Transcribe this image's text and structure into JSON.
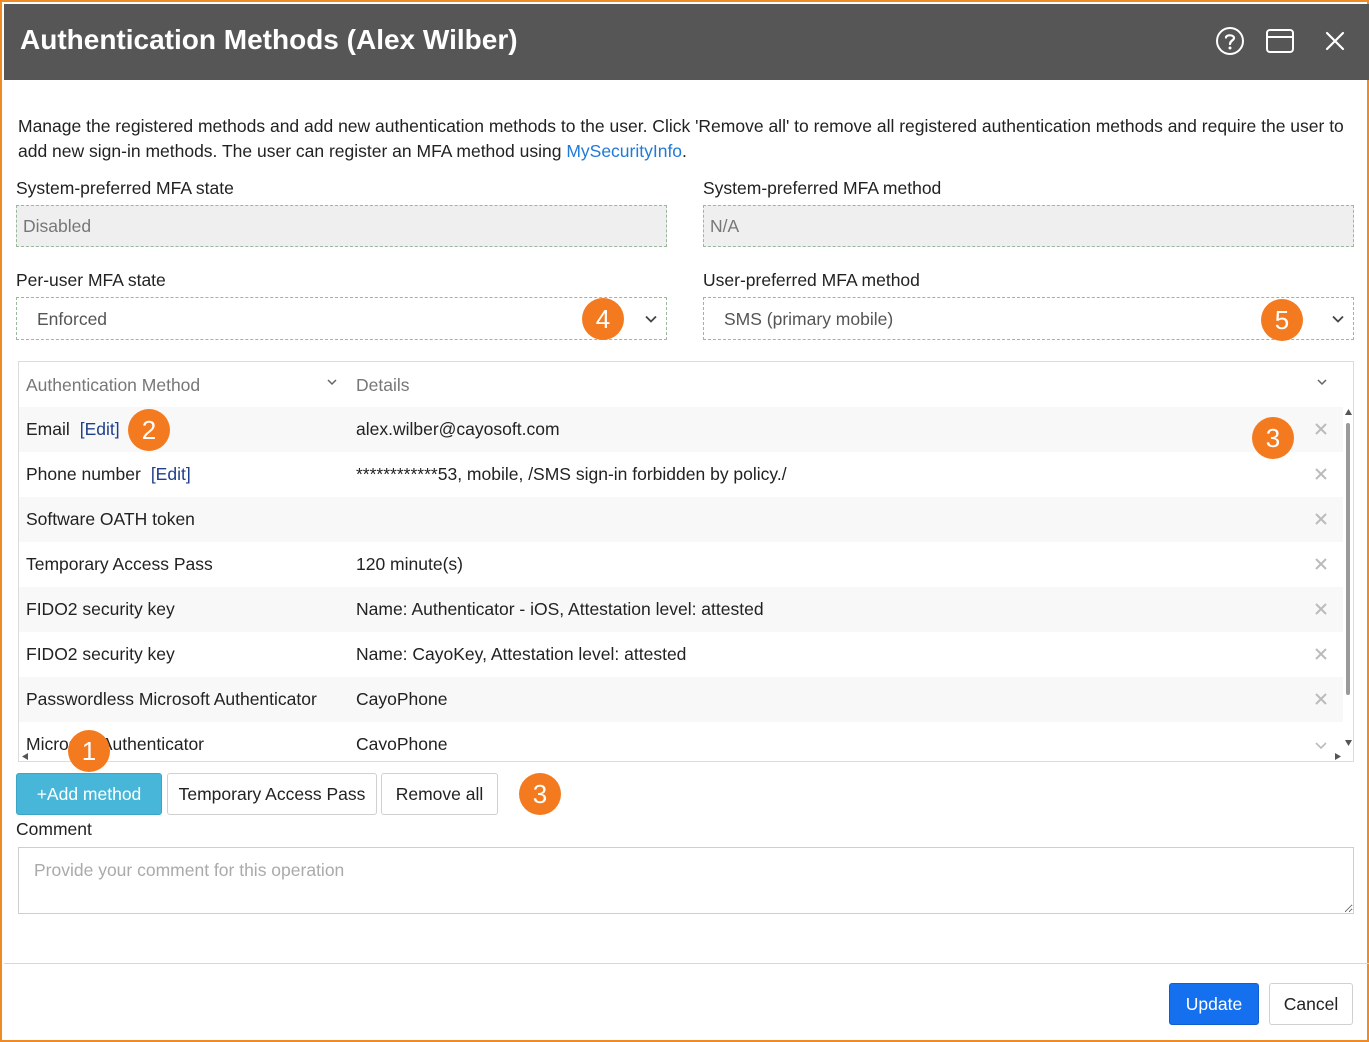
{
  "window": {
    "title": "Authentication Methods (Alex Wilber)",
    "icons": [
      "help-icon",
      "maximize-icon",
      "close-icon"
    ]
  },
  "description": {
    "text": "Manage the registered methods and add new authentication methods to the user. Click 'Remove all' to remove all registered authentication methods and require the user to add new sign-in methods. The user can register an MFA method using ",
    "link": "MySecurityInfo",
    "suffix": "."
  },
  "fields": {
    "system_state_label": "System-preferred MFA state",
    "system_state_value": "Disabled",
    "system_method_label": "System-preferred MFA method",
    "system_method_value": "N/A",
    "peruser_state_label": "Per-user MFA state",
    "peruser_state_value": "Enforced",
    "user_method_label": "User-preferred MFA method",
    "user_method_value": "SMS (primary mobile)"
  },
  "grid": {
    "col_method": "Authentication Method",
    "col_details": "Details",
    "edit_label": "[Edit]",
    "rows": [
      {
        "method": "Email",
        "details": "alex.wilber@cayosoft.com"
      },
      {
        "method": "Phone number",
        "details": "************53, mobile, /SMS sign-in forbidden by policy./"
      },
      {
        "method": "Software OATH token",
        "details": ""
      },
      {
        "method": "Temporary Access Pass",
        "details": "120 minute(s)"
      },
      {
        "method": "FIDO2 security key",
        "details": "Name: Authenticator - iOS, Attestation level: attested"
      },
      {
        "method": "FIDO2 security key",
        "details": "Name: CayoKey, Attestation level: attested"
      },
      {
        "method": "Passwordless Microsoft Authenticator",
        "details": "CayoPhone"
      },
      {
        "method": "Microsoft Authenticator",
        "details": "CayoPhone"
      }
    ]
  },
  "buttons": {
    "add_method": "+Add method",
    "tap": "Temporary Access Pass",
    "remove_all": "Remove all",
    "update": "Update",
    "cancel": "Cancel"
  },
  "comment": {
    "label": "Comment",
    "placeholder": "Provide your comment for this operation"
  },
  "callouts": {
    "c1": "1",
    "c2": "2",
    "c3": "3",
    "c4": "4",
    "c5": "5"
  },
  "colors": {
    "titlebar": "#565656",
    "frame": "#f08a24",
    "callout": "#f47a1f",
    "add_button": "#48b6d8",
    "update_button": "#1570ef",
    "link": "#1f7ad8"
  }
}
